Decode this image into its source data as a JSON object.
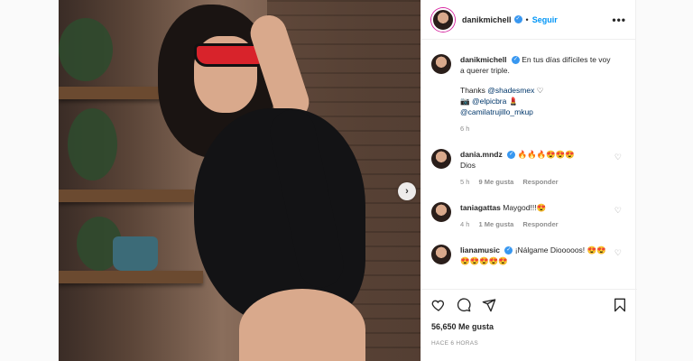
{
  "post": {
    "username": "danikmichell",
    "follow_label": "Seguir",
    "caption_line": "En tus días difíciles te voy a querer triple.",
    "thanks_prefix": "Thanks",
    "thanks_handle": "@shadesmex",
    "thanks_emoji": "♡",
    "camera_emoji": "📷",
    "photo_handle": "@elpicbra",
    "lipstick_emoji": "💄",
    "mkup_handle": "@camilatrujillo_mkup",
    "caption_time": "6 h"
  },
  "comments": [
    {
      "username": "dania.mndz",
      "text": "Dios",
      "emoji": "🔥🔥🔥😍😍😍",
      "time": "5 h",
      "likes": "9 Me gusta",
      "reply": "Responder"
    },
    {
      "username": "taniagattas",
      "text": "Maygod!!!",
      "emoji": "😍",
      "time": "4 h",
      "likes": "1 Me gusta",
      "reply": "Responder"
    },
    {
      "username": "lianamusic",
      "text": "¡Nálgame Diooooos!",
      "emoji": "😍😍😍😍😍😍😍",
      "time": "",
      "likes": "",
      "reply": ""
    }
  ],
  "footer": {
    "likes": "56,650 Me gusta",
    "ago": "HACE 6 HORAS"
  },
  "icons": {
    "next": "›",
    "more": "•••",
    "heart": "♡",
    "verified": "✓"
  },
  "colors": {
    "link_blue": "#0095f6",
    "verified_blue": "#3897f0",
    "text": "#262626",
    "meta": "#8e8e8e"
  }
}
